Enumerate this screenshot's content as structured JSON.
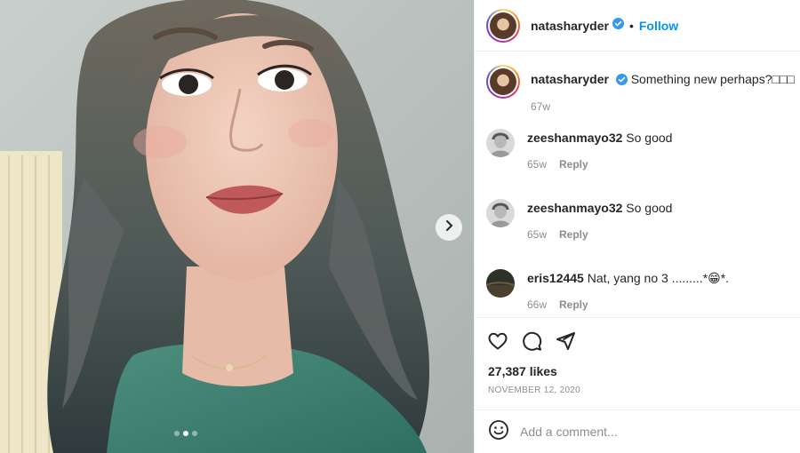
{
  "post": {
    "owner": "natasharyder",
    "separator": "•",
    "follow_label": "Follow",
    "carousel": {
      "slides": 3,
      "active_index": 1
    }
  },
  "comments": [
    {
      "user": "natasharyder",
      "verified": true,
      "text": "Something new perhaps?□□□",
      "age": "67w",
      "reply": ""
    },
    {
      "user": "zeeshanmayo32",
      "verified": false,
      "text": "So good",
      "age": "65w",
      "reply": "Reply"
    },
    {
      "user": "zeeshanmayo32",
      "verified": false,
      "text": "So good",
      "age": "65w",
      "reply": "Reply"
    },
    {
      "user": "eris12445",
      "verified": false,
      "text": "Nat, yang no 3 .........*😁*.",
      "age": "66w",
      "reply": "Reply"
    }
  ],
  "stats": {
    "likes": "27,387 likes",
    "date": "NOVEMBER 12, 2020"
  },
  "composer": {
    "placeholder": "Add a comment..."
  },
  "colors": {
    "accent": "#0095f6",
    "verified": "#3897f0",
    "muted": "#8e8e8e",
    "text": "#262626"
  },
  "icons": [
    "chevron-right-icon",
    "verified-badge-icon",
    "heart-icon",
    "comment-icon",
    "share-icon",
    "emoji-icon"
  ]
}
